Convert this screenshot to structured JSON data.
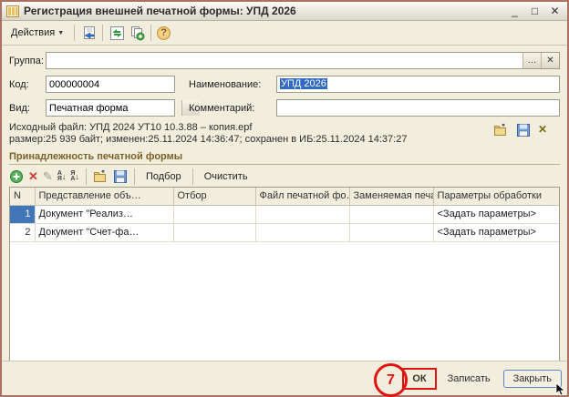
{
  "window": {
    "title": "Регистрация внешней печатной формы: УПД 2026",
    "controls": {
      "minimize": "_",
      "maximize": "□",
      "close": "✕"
    }
  },
  "toolbar": {
    "actions_label": "Действия",
    "dropdown_caret": "▼",
    "help_glyph": "?"
  },
  "fields": {
    "group": {
      "label": "Группа:",
      "value": "",
      "dots": "…",
      "clear": "✕"
    },
    "code": {
      "label": "Код:",
      "value": "000000004"
    },
    "name": {
      "label": "Наименование:",
      "value": "УПД 2026"
    },
    "kind": {
      "label": "Вид:",
      "value": "Печатная форма",
      "dots": "…"
    },
    "comment": {
      "label": "Комментарий:",
      "value": ""
    }
  },
  "fileinfo": {
    "line1": "Исходный файл: УПД 2024 УТ10 10.3.88 – копия.epf",
    "line2": "размер:25 939 байт; изменен:25.11.2024 14:36:47; сохранен в ИБ:25.11.2024 14:37:27",
    "clear_glyph": "✕"
  },
  "section": {
    "title": "Принадлежность печатной формы"
  },
  "table_toolbar": {
    "add_glyph": "+",
    "delete_glyph": "✕",
    "edit_glyph": "✎",
    "sort_asc_letters": [
      "А",
      "Я"
    ],
    "sort_desc_letters": [
      "Я",
      "А"
    ],
    "sort_arrow": "↓",
    "pick_label": "Подбор",
    "clear_label": "Очистить"
  },
  "table": {
    "columns": [
      "N",
      "Представление объ…",
      "Отбор",
      "Файл печатной фо…",
      "Заменяемая печатн…",
      "Параметры обработки"
    ],
    "rows": [
      {
        "n": "1",
        "repr": "Документ \"Реализ…",
        "filter": "",
        "file": "",
        "replaced": "",
        "params": "<Задать параметры>"
      },
      {
        "n": "2",
        "repr": "Документ \"Счет-фа…",
        "filter": "",
        "file": "",
        "replaced": "",
        "params": "<Задать параметры>"
      }
    ]
  },
  "bottom": {
    "annotation": "7",
    "ok_label": "ОК",
    "write_label": "Записать",
    "close_label": "Закрыть"
  },
  "colors": {
    "dialog_bg": "#f1eedd",
    "selection_blue": "#316ac5",
    "annotation_red": "#e01212",
    "section_brown": "#7c6228"
  }
}
